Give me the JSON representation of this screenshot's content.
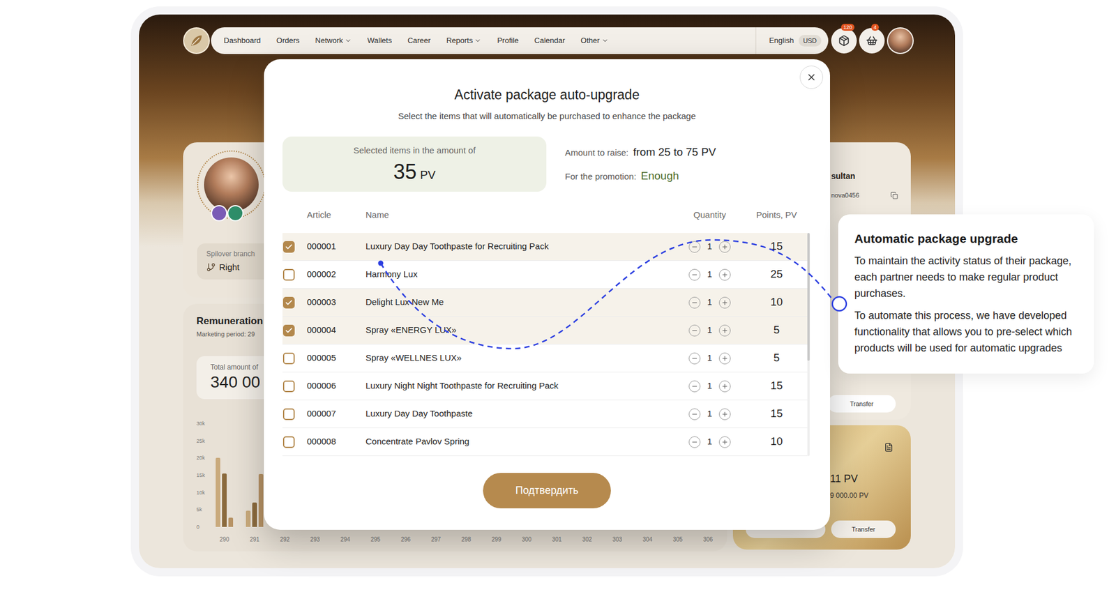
{
  "nav": {
    "items": [
      {
        "label": "Dashboard",
        "dropdown": false
      },
      {
        "label": "Orders",
        "dropdown": false
      },
      {
        "label": "Network",
        "dropdown": true
      },
      {
        "label": "Wallets",
        "dropdown": false
      },
      {
        "label": "Career",
        "dropdown": false
      },
      {
        "label": "Reports",
        "dropdown": true
      },
      {
        "label": "Profile",
        "dropdown": false
      },
      {
        "label": "Calendar",
        "dropdown": false
      },
      {
        "label": "Other",
        "dropdown": true
      }
    ],
    "language": "English",
    "currency": "USD",
    "package_badge": "120",
    "cart_badge": "4"
  },
  "profile": {
    "spillover_label": "Spilover branch",
    "spillover_value": "Right"
  },
  "remuneration": {
    "title": "Remuneration",
    "period": "Marketing period: 29",
    "total_label": "Total amount of",
    "total_value": "340 00",
    "chart": {
      "y_ticks": [
        "30k",
        "25k",
        "20k",
        "15k",
        "10k",
        "5k",
        "0"
      ],
      "x_labels": [
        "290",
        "291",
        "292",
        "293",
        "294",
        "295",
        "296",
        "297",
        "298",
        "299",
        "300",
        "301",
        "302",
        "303",
        "304",
        "305",
        "306"
      ],
      "series": [
        {
          "color": "#c9aa7c",
          "values": [
            20000,
            4700,
            0,
            0,
            0,
            0,
            0,
            0,
            0,
            0,
            0,
            0,
            0,
            0,
            0,
            0,
            0
          ]
        },
        {
          "color": "#8b6a3d",
          "values": [
            15500,
            7000,
            0,
            0,
            0,
            0,
            0,
            0,
            0,
            0,
            0,
            0,
            0,
            0,
            0,
            0,
            0
          ]
        },
        {
          "color": "#b89466",
          "values": [
            2700,
            15400,
            0,
            0,
            0,
            0,
            0,
            0,
            0,
            0,
            0,
            0,
            0,
            0,
            0,
            0,
            0
          ]
        }
      ]
    }
  },
  "wallet": {
    "name": "sultan",
    "login": "nova0456",
    "balance_pv": "11 PV",
    "balance_amount": "9 000.00 PV",
    "transfer_buttons": [
      "Transfer",
      "Transfer"
    ]
  },
  "modal": {
    "title": "Activate package auto-upgrade",
    "subtitle": "Select the items that will automatically be purchased to enhance the package",
    "summary_label": "Selected items in the amount of",
    "summary_value": "35",
    "summary_unit": "PV",
    "raise_label": "Amount to raise:",
    "raise_value": "from 25 to 75 PV",
    "promotion_label": "For the promotion:",
    "promotion_value": "Enough",
    "columns": [
      "Article",
      "Name",
      "Quantity",
      "Points, PV"
    ],
    "rows": [
      {
        "article": "000001",
        "name": "Luxury Day Day Toothpaste for Recruiting Pack",
        "quantity": "1",
        "points": "15",
        "checked": true
      },
      {
        "article": "000002",
        "name": "Harmony Lux",
        "quantity": "1",
        "points": "25",
        "checked": false
      },
      {
        "article": "000003",
        "name": "Delight Lux New Me",
        "quantity": "1",
        "points": "10",
        "checked": true
      },
      {
        "article": "000004",
        "name": "Spray «ENERGY LUX»",
        "quantity": "1",
        "points": "5",
        "checked": true
      },
      {
        "article": "000005",
        "name": "Spray «WELLNES LUX»",
        "quantity": "1",
        "points": "5",
        "checked": false
      },
      {
        "article": "000006",
        "name": "Luxury Night Night Toothpaste for Recruiting Pack",
        "quantity": "1",
        "points": "15",
        "checked": false
      },
      {
        "article": "000007",
        "name": "Luxury Day Day Toothpaste",
        "quantity": "1",
        "points": "15",
        "checked": false
      },
      {
        "article": "000008",
        "name": "Concentrate Pavlov Spring",
        "quantity": "1",
        "points": "10",
        "checked": false
      }
    ],
    "confirm": "Подтвердить"
  },
  "callout": {
    "title": "Automatic package upgrade",
    "paragraphs": [
      "To maintain the activity status of their package, each partner needs to make regular product purchases.",
      "To automate this process, we have developed functionality that allows you to pre-select which products will be used for automatic upgrades"
    ]
  }
}
